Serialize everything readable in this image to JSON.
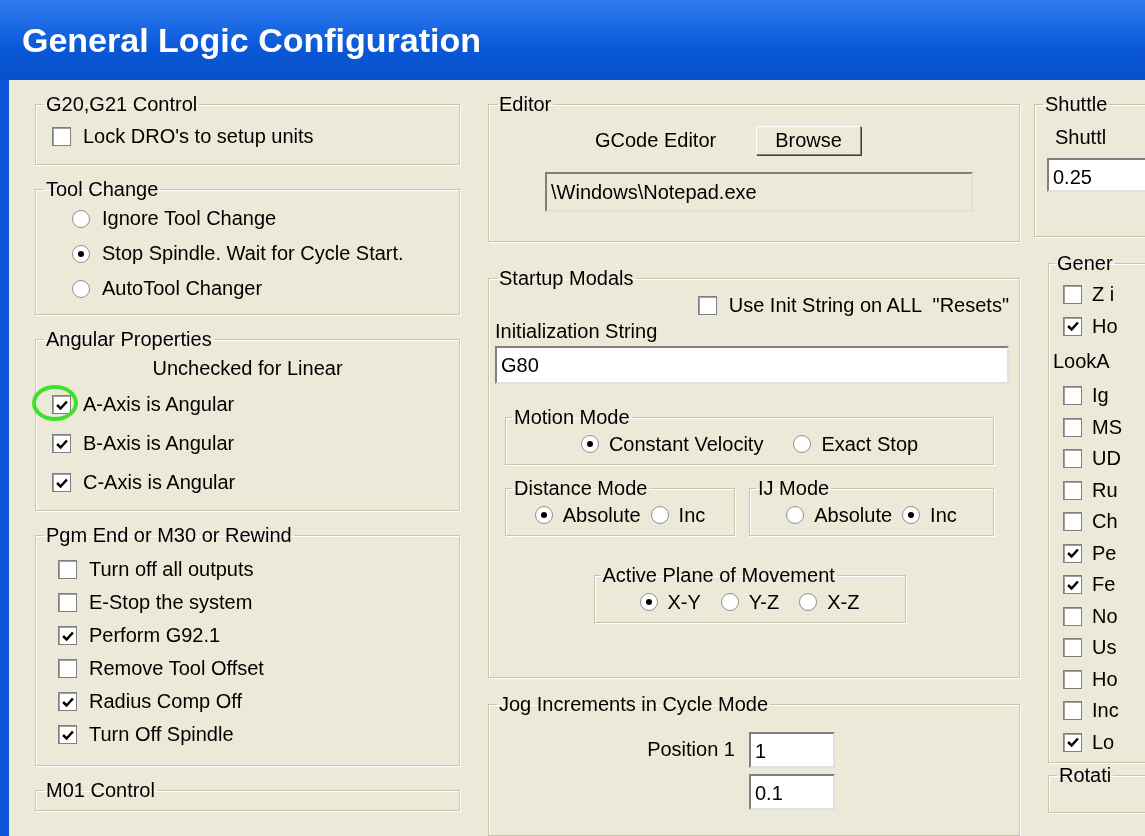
{
  "window": {
    "title": "General Logic Configuration"
  },
  "left_groups": [
    {
      "title": "G20,G21 Control",
      "items": [
        {
          "kind": "checkbox",
          "label": "Lock DRO's to setup units",
          "checked": false
        }
      ]
    },
    {
      "title": "Tool Change",
      "items": [
        {
          "kind": "radio",
          "label": "Ignore Tool Change",
          "selected": false
        },
        {
          "kind": "radio",
          "label": "Stop Spindle. Wait for Cycle Start.",
          "selected": true
        },
        {
          "kind": "radio",
          "label": "AutoTool Changer",
          "selected": false
        }
      ]
    },
    {
      "title": "Angular Properties",
      "items": [
        {
          "kind": "note",
          "label": "Unchecked for Linear"
        },
        {
          "kind": "checkbox",
          "label": "A-Axis is Angular",
          "checked": true,
          "circled": true
        },
        {
          "kind": "checkbox",
          "label": "B-Axis is Angular",
          "checked": true
        },
        {
          "kind": "checkbox",
          "label": "C-Axis is Angular",
          "checked": true
        }
      ]
    },
    {
      "title": "Pgm End or M30 or Rewind",
      "items": [
        {
          "kind": "checkbox",
          "label": "Turn off all outputs",
          "checked": false
        },
        {
          "kind": "checkbox",
          "label": "E-Stop the system",
          "checked": false
        },
        {
          "kind": "checkbox",
          "label": "Perform G92.1",
          "checked": true
        },
        {
          "kind": "checkbox",
          "label": "Remove Tool Offset",
          "checked": false
        },
        {
          "kind": "checkbox",
          "label": "Radius Comp Off",
          "checked": true
        },
        {
          "kind": "checkbox",
          "label": "Turn Off Spindle",
          "checked": true
        }
      ]
    },
    {
      "title": "M01 Control"
    }
  ],
  "editor": {
    "title": "Editor",
    "label": "GCode Editor",
    "button": "Browse",
    "path": "\\Windows\\Notepad.exe"
  },
  "startup_modals": {
    "title": "Startup Modals",
    "use_init": {
      "label": "Use Init String on ALL  \"Resets\"",
      "checked": false
    },
    "init_label": "Initialization String",
    "init_value": "G80",
    "modes": [
      {
        "title": "Motion Mode",
        "options": [
          {
            "label": "Constant Velocity",
            "selected": true
          },
          {
            "label": "Exact Stop",
            "selected": false
          }
        ]
      },
      {
        "title": "Distance Mode",
        "options": [
          {
            "label": "Absolute",
            "selected": true
          },
          {
            "label": "Inc",
            "selected": false
          }
        ]
      },
      {
        "title": "IJ Mode",
        "options": [
          {
            "label": "Absolute",
            "selected": false
          },
          {
            "label": "Inc",
            "selected": true
          }
        ]
      },
      {
        "title": "Active Plane of Movement",
        "options": [
          {
            "label": "X-Y",
            "selected": true
          },
          {
            "label": "Y-Z",
            "selected": false
          },
          {
            "label": "X-Z",
            "selected": false
          }
        ]
      }
    ]
  },
  "jog": {
    "title": "Jog Increments in Cycle Mode",
    "label": "Position 1",
    "values": [
      "1",
      "0.1"
    ]
  },
  "right": {
    "shuttle": {
      "title": "Shuttle",
      "label": "Shuttl",
      "value": "0.25"
    },
    "general": {
      "title": "Gener",
      "items": [
        {
          "kind": "checkbox",
          "label": "Z i",
          "checked": false
        },
        {
          "kind": "checkbox",
          "label": "Ho",
          "checked": true
        },
        {
          "kind": "heading",
          "label": "LookA"
        },
        {
          "kind": "checkbox",
          "label": "Ig",
          "checked": false
        },
        {
          "kind": "checkbox",
          "label": "MS",
          "checked": false
        },
        {
          "kind": "checkbox",
          "label": "UD",
          "checked": false
        },
        {
          "kind": "checkbox",
          "label": "Ru",
          "checked": false
        },
        {
          "kind": "checkbox",
          "label": "Ch",
          "checked": false
        },
        {
          "kind": "checkbox",
          "label": "Pe",
          "checked": true
        },
        {
          "kind": "checkbox",
          "label": "Fe",
          "checked": true
        },
        {
          "kind": "checkbox",
          "label": "No",
          "checked": false
        },
        {
          "kind": "checkbox",
          "label": "Us",
          "checked": false
        },
        {
          "kind": "checkbox",
          "label": "Ho",
          "checked": false
        },
        {
          "kind": "checkbox",
          "label": "Inc",
          "checked": false
        },
        {
          "kind": "checkbox",
          "label": "Lo",
          "checked": true
        }
      ]
    },
    "next_group_title": "Rotati"
  }
}
